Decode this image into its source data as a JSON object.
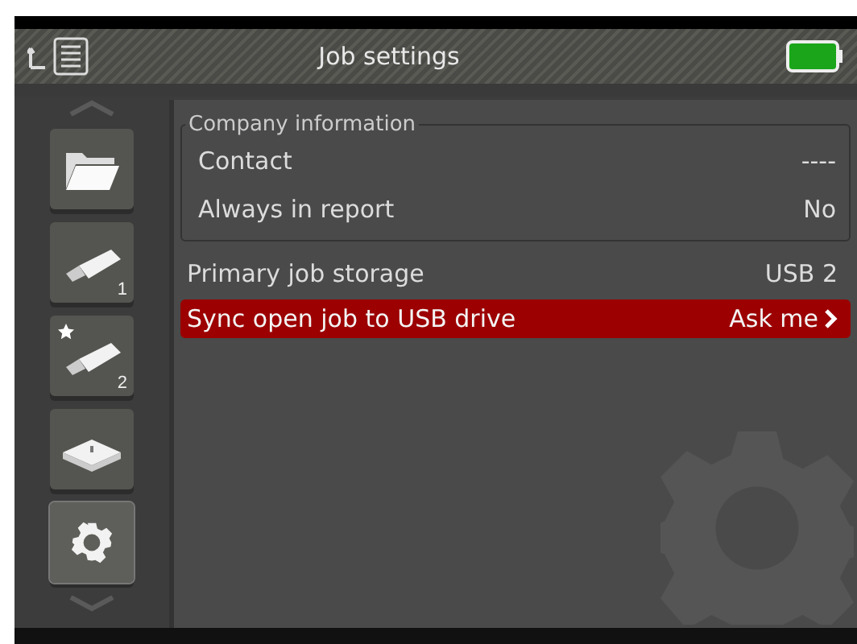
{
  "header": {
    "title": "Job settings"
  },
  "sidebar": {
    "items": [
      {
        "kind": "folder",
        "starred": false,
        "selected": false
      },
      {
        "kind": "usb",
        "badge": "1",
        "starred": false,
        "selected": false
      },
      {
        "kind": "usb",
        "badge": "2",
        "starred": true,
        "selected": false
      },
      {
        "kind": "drive",
        "starred": false,
        "selected": false
      },
      {
        "kind": "gear",
        "starred": false,
        "selected": true
      }
    ]
  },
  "group": {
    "title": "Company information",
    "rows": [
      {
        "label": "Contact",
        "value": "----",
        "selected": false
      },
      {
        "label": "Always in report",
        "value": "No",
        "selected": false
      }
    ]
  },
  "rows": [
    {
      "label": "Primary job storage",
      "value": "USB 2",
      "selected": false,
      "submenu": false
    },
    {
      "label": "Sync open job to USB drive",
      "value": "Ask me",
      "selected": true,
      "submenu": true
    }
  ]
}
